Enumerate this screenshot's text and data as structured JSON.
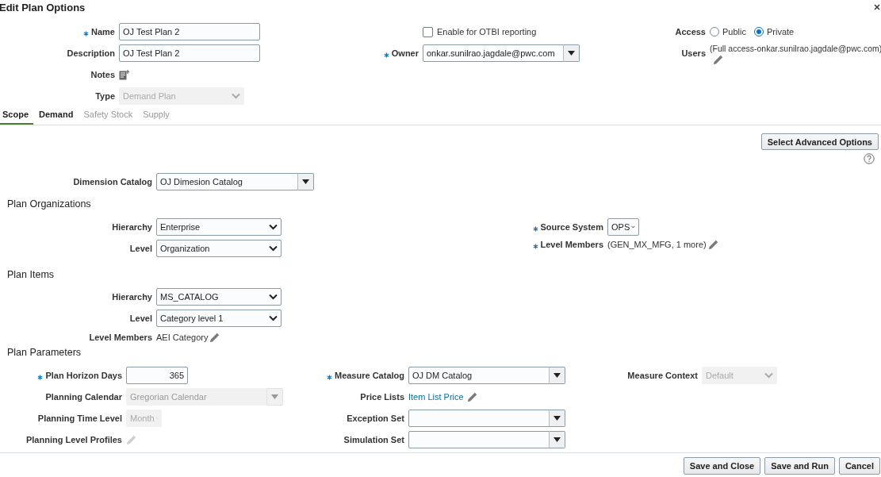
{
  "title": "Edit Plan Options",
  "top": {
    "columns": [
      [
        {
          "kind": "text",
          "label": "Name",
          "required": true,
          "disabled": false,
          "value": "OJ Test Plan 2"
        },
        {
          "kind": "text",
          "label": "Description",
          "required": false,
          "disabled": false,
          "value": "OJ Test Plan 2"
        },
        {
          "kind": "notes",
          "label": "Notes",
          "required": false,
          "disabled": false
        },
        {
          "kind": "select",
          "label": "Type",
          "required": false,
          "disabled": true,
          "value": "Demand Plan"
        }
      ],
      [
        {
          "kind": "checkbox",
          "text": "Enable for OTBI reporting",
          "checked": false,
          "disabled": false
        },
        {
          "kind": "combo",
          "label": "Owner",
          "required": true,
          "disabled": false,
          "value": "onkar.sunilrao.jagdale@pwc.com"
        }
      ],
      [
        {
          "kind": "radio",
          "label": "Access",
          "required": false,
          "disabled": false,
          "options": [
            {
              "text": "Public",
              "selected": false
            },
            {
              "text": "Private",
              "selected": true
            }
          ]
        },
        {
          "kind": "stacked",
          "label": "Users",
          "required": false,
          "disabled": false,
          "value": "(Full access-onkar.sunilrao.jagdale@pwc.com)"
        }
      ]
    ]
  },
  "tabs": [
    {
      "label": "Scope",
      "selected": true,
      "disabled": false
    },
    {
      "label": "Demand",
      "selected": false,
      "disabled": false
    },
    {
      "label": "Safety Stock",
      "selected": false,
      "disabled": true
    },
    {
      "label": "Supply",
      "selected": false,
      "disabled": true
    }
  ],
  "advanced_button": "Select Advanced Options",
  "dimension": {
    "columns": [
      [
        {
          "kind": "combo",
          "label": "Dimension Catalog",
          "required": false,
          "disabled": false,
          "value": "OJ Dimesion Catalog"
        }
      ]
    ]
  },
  "sections": [
    {
      "heading": "Plan Organizations",
      "columns": [
        [
          {
            "kind": "select",
            "label": "Hierarchy",
            "required": false,
            "disabled": false,
            "value": "Enterprise"
          },
          {
            "kind": "select",
            "label": "Level",
            "required": false,
            "disabled": false,
            "value": "Organization"
          }
        ],
        [
          {
            "kind": "select",
            "label": "Source System",
            "required": true,
            "disabled": false,
            "value": "OPS"
          },
          {
            "kind": "display",
            "label": "Level Members",
            "required": true,
            "disabled": false,
            "value": "(GEN_MX_MFG, 1 more)"
          }
        ]
      ]
    },
    {
      "heading": "Plan Items",
      "columns": [
        [
          {
            "kind": "select",
            "label": "Hierarchy",
            "required": false,
            "disabled": false,
            "value": "MS_CATALOG"
          },
          {
            "kind": "select",
            "label": "Level",
            "required": false,
            "disabled": false,
            "value": "Category level 1"
          },
          {
            "kind": "display",
            "label": "Level Members",
            "required": false,
            "disabled": false,
            "value": "AEI Category"
          }
        ]
      ]
    },
    {
      "heading": "Plan Parameters",
      "columns": [
        [
          {
            "kind": "number",
            "label": "Plan Horizon Days",
            "required": true,
            "disabled": false,
            "value": "365"
          },
          {
            "kind": "combo",
            "label": "Planning Calendar",
            "required": false,
            "disabled": true,
            "value": "Gregorian Calendar"
          },
          {
            "kind": "select",
            "label": "Planning Time Level",
            "required": false,
            "disabled": true,
            "value": "Month"
          },
          {
            "kind": "pencil",
            "label": "Planning Level Profiles",
            "required": false,
            "disabled": true
          }
        ],
        [
          {
            "kind": "combo",
            "label": "Measure Catalog",
            "required": true,
            "disabled": false,
            "value": "OJ DM Catalog"
          },
          {
            "kind": "link",
            "label": "Price Lists",
            "required": false,
            "disabled": false,
            "value": "Item List Price"
          },
          {
            "kind": "combo",
            "label": "Exception Set",
            "required": false,
            "disabled": false
          },
          {
            "kind": "combo",
            "label": "Simulation Set",
            "required": false,
            "disabled": false
          }
        ],
        [
          {
            "kind": "select",
            "label": "Measure Context",
            "required": false,
            "disabled": true,
            "value": "Default"
          }
        ]
      ]
    }
  ],
  "buttons": [
    "Save and Close",
    "Save and Run",
    "Cancel"
  ]
}
